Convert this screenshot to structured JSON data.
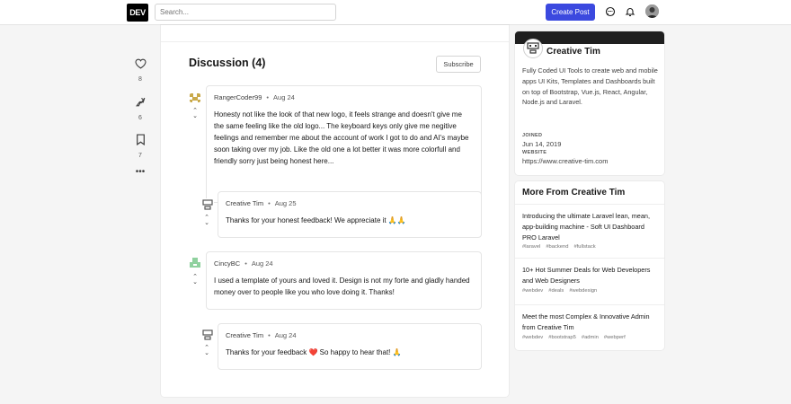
{
  "header": {
    "logo_text": "DEV",
    "search_placeholder": "Search...",
    "create_post_label": "Create Post",
    "icons": [
      "chat-icon",
      "bell-icon",
      "user-avatar"
    ]
  },
  "reactions": [
    {
      "icon": "heart-icon",
      "count": "8"
    },
    {
      "icon": "unicorn-icon",
      "count": "6"
    },
    {
      "icon": "bookmark-icon",
      "count": "7"
    },
    {
      "icon": "more-icon",
      "count": ""
    }
  ],
  "discussion": {
    "title": "Discussion (4)",
    "subscribe_label": "Subscribe",
    "comments": [
      {
        "author": "RangerCoder99",
        "date": "Aug 24",
        "body": "Honesty not like the look of that new logo, it feels strange and doesn't give me the same feeling like the old logo... The keyboard keys only give me negitive feelings and remember me about the account of work I got to do and AI's maybe soon taking over my job. Like the old one a lot better it was more colorfull and friendly sorry just being honest here..."
      },
      {
        "author": "Creative Tim",
        "date": "Aug 25",
        "body": "Thanks for your honest feedback! We appreciate it 🙏🙏"
      },
      {
        "author": "CincyBC",
        "date": "Aug 24",
        "body": "I used a template of yours and loved it. Design is not my forte and gladly handed money over to people like you who love doing it. Thanks!"
      },
      {
        "author": "Creative Tim",
        "date": "Aug 24",
        "body": "Thanks for your feedback ❤️ So happy to hear that! 🙏"
      }
    ]
  },
  "sidebar": {
    "name": "Creative Tim",
    "description": "Fully Coded UI Tools to create web and mobile apps UI Kits, Templates and Dashboards built on top of Bootstrap, Vue.js, React, Angular, Node.js and Laravel.",
    "joined_label": "JOINED",
    "joined_value": "Jun 14, 2019",
    "website_label": "WEBSITE",
    "website_value": "https://www.creative-tim.com",
    "more_title": "More From Creative Tim",
    "more_items": [
      {
        "title": "Introducing the ultimate Laravel lean, mean, app-building machine - Soft UI Dashboard PRO Laravel",
        "tags": [
          "#laravel",
          "#backend",
          "#fullstack"
        ]
      },
      {
        "title": "10+ Hot Summer Deals for Web Developers and Web Designers",
        "tags": [
          "#webdev",
          "#deals",
          "#webdesign"
        ]
      },
      {
        "title": "Meet the most Complex & Innovative Admin from Creative Tim",
        "tags": [
          "#webdev",
          "#bootstrap5",
          "#admin",
          "#webperf"
        ]
      }
    ]
  },
  "colors": {
    "accent": "#3b49df",
    "heart": "#dc1818",
    "background": "#f5f5f5"
  }
}
